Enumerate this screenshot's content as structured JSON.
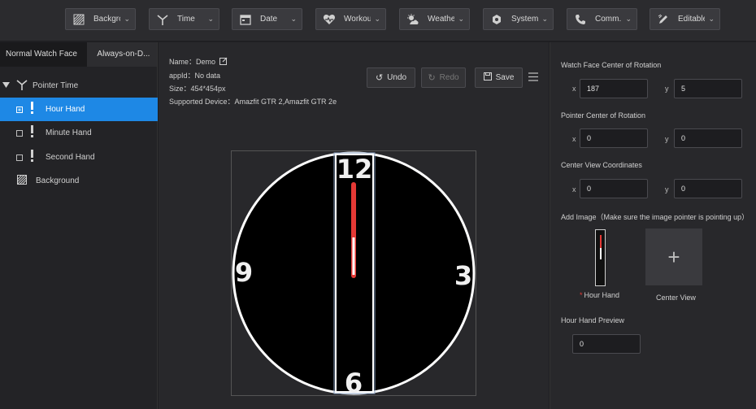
{
  "toolbar": {
    "items": [
      {
        "label": "Backgro...",
        "icon": "background-icon"
      },
      {
        "label": "Time",
        "icon": "pointer-icon"
      },
      {
        "label": "Date",
        "icon": "calendar-icon"
      },
      {
        "label": "Workou...",
        "icon": "heart-icon"
      },
      {
        "label": "Weather",
        "icon": "weather-icon"
      },
      {
        "label": "System",
        "icon": "system-icon"
      },
      {
        "label": "Comm...",
        "icon": "phone-icon"
      },
      {
        "label": "Editable",
        "icon": "edit-icon"
      }
    ]
  },
  "left": {
    "tabs": [
      "Normal Watch Face",
      "Always-on-D..."
    ],
    "tree": [
      {
        "label": "Pointer Time"
      },
      {
        "label": "Hour Hand"
      },
      {
        "label": "Minute Hand"
      },
      {
        "label": "Second Hand"
      },
      {
        "label": "Background"
      }
    ]
  },
  "center": {
    "info": {
      "name_label": "Name：",
      "name_value": "Demo",
      "appid_label": "appId：",
      "appid_value": "No data",
      "size_label": "Size：",
      "size_value": "454*454px",
      "device_label": "Supported Device：",
      "device_value": "Amazfit GTR 2,Amazfit GTR 2e"
    },
    "undo_label": "Undo",
    "redo_label": "Redo",
    "save_label": "Save",
    "dial": {
      "n12": "12",
      "n3": "3",
      "n6": "6",
      "n9": "9"
    }
  },
  "right": {
    "rotation_center_title": "Watch Face Center of Rotation",
    "rotation_x": "187",
    "rotation_y": "5",
    "pointer_center_title": "Pointer Center of Rotation",
    "pointer_x": "0",
    "pointer_y": "0",
    "center_view_title": "Center View Coordinates",
    "view_x": "0",
    "view_y": "0",
    "add_image_title": "Add Image（Make sure the image pointer is pointing up）",
    "hour_hand_caption": "Hour Hand",
    "required_mark": "*",
    "center_view_caption": "Center View",
    "add_glyph": "+",
    "preview_title": "Hour Hand Preview",
    "preview_value": "0",
    "axis_x": "x",
    "axis_y": "y"
  },
  "colors": {
    "accent": "#1e88e5",
    "hand_red": "#e53935"
  }
}
